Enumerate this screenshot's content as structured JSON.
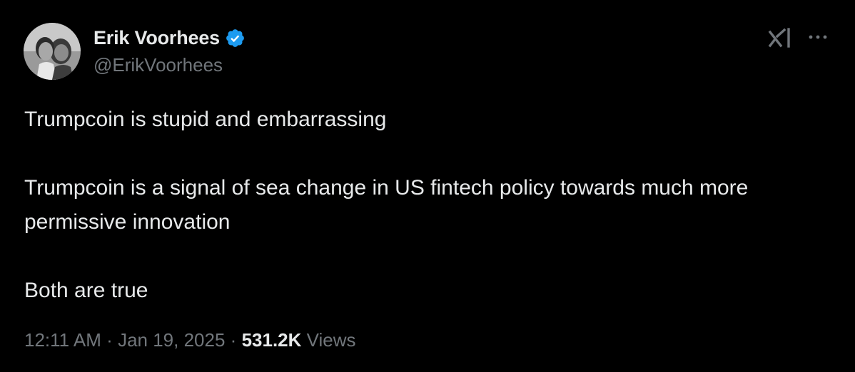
{
  "author": {
    "display_name": "Erik Voorhees",
    "handle": "@ErikVoorhees",
    "verified": true,
    "verified_color": "#1d9bf0"
  },
  "header_icons": {
    "logo": "xai-logo-icon",
    "more": "more-options-icon"
  },
  "tweet": {
    "paragraphs": [
      "Trumpcoin is stupid and embarrassing",
      "Trumpcoin is a signal of sea change in US fintech policy towards much more permissive innovation",
      "Both are true"
    ]
  },
  "meta": {
    "time": "12:11 AM",
    "separator": "·",
    "date": "Jan 19, 2025",
    "views_count": "531.2K",
    "views_label": "Views"
  },
  "colors": {
    "background": "#000000",
    "text_primary": "#e7e9ea",
    "text_secondary": "#71767b"
  }
}
